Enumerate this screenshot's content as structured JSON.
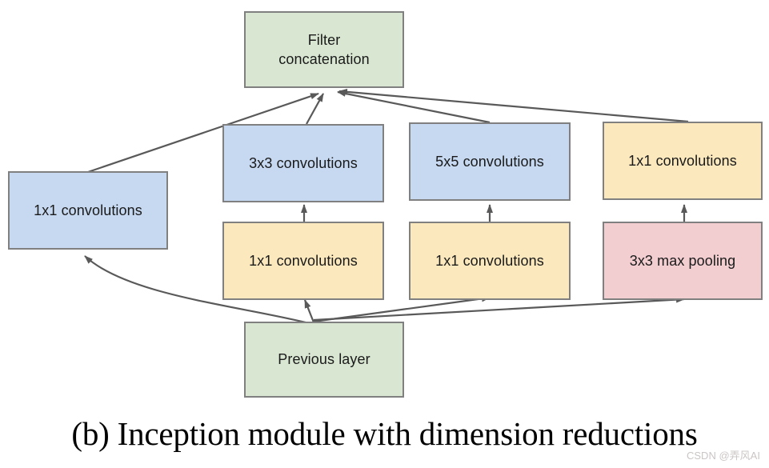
{
  "figure": {
    "caption": "(b) Inception module with dimension reductions",
    "watermark": "CSDN @弄风AI",
    "background_color": "#ffffff",
    "edge_color": "#595959",
    "border_color": "#808080"
  },
  "colors": {
    "green": "#d9e7d2",
    "blue": "#c6d9f1",
    "yellow": "#fbe8bd",
    "red": "#f3ced1"
  },
  "nodes": {
    "filter_concatenation": {
      "label_line1": "Filter",
      "label_line2": "concatenation",
      "color": "#d9e7d2"
    },
    "conv3x3": {
      "label": "3x3 convolutions",
      "color": "#c6d9f1"
    },
    "conv5x5": {
      "label": "5x5 convolutions",
      "color": "#c6d9f1"
    },
    "conv1x1_right_top": {
      "label": "1x1 convolutions",
      "color": "#fbe8bd"
    },
    "conv1x1_left": {
      "label": "1x1 convolutions",
      "color": "#c6d9f1"
    },
    "conv1x1_reduce_a": {
      "label": "1x1 convolutions",
      "color": "#fbe8bd"
    },
    "conv1x1_reduce_b": {
      "label": "1x1 convolutions",
      "color": "#fbe8bd"
    },
    "maxpool3x3": {
      "label": "3x3 max pooling",
      "color": "#f3ced1"
    },
    "previous_layer": {
      "label": "Previous layer",
      "color": "#d9e7d2"
    }
  },
  "edges": [
    {
      "from": "previous_layer",
      "to": "conv1x1_left"
    },
    {
      "from": "previous_layer",
      "to": "conv1x1_reduce_a"
    },
    {
      "from": "previous_layer",
      "to": "conv1x1_reduce_b"
    },
    {
      "from": "previous_layer",
      "to": "maxpool3x3"
    },
    {
      "from": "conv1x1_reduce_a",
      "to": "conv3x3"
    },
    {
      "from": "conv1x1_reduce_b",
      "to": "conv5x5"
    },
    {
      "from": "maxpool3x3",
      "to": "conv1x1_right_top"
    },
    {
      "from": "conv1x1_left",
      "to": "filter_concatenation"
    },
    {
      "from": "conv3x3",
      "to": "filter_concatenation"
    },
    {
      "from": "conv5x5",
      "to": "filter_concatenation"
    },
    {
      "from": "conv1x1_right_top",
      "to": "filter_concatenation"
    }
  ]
}
